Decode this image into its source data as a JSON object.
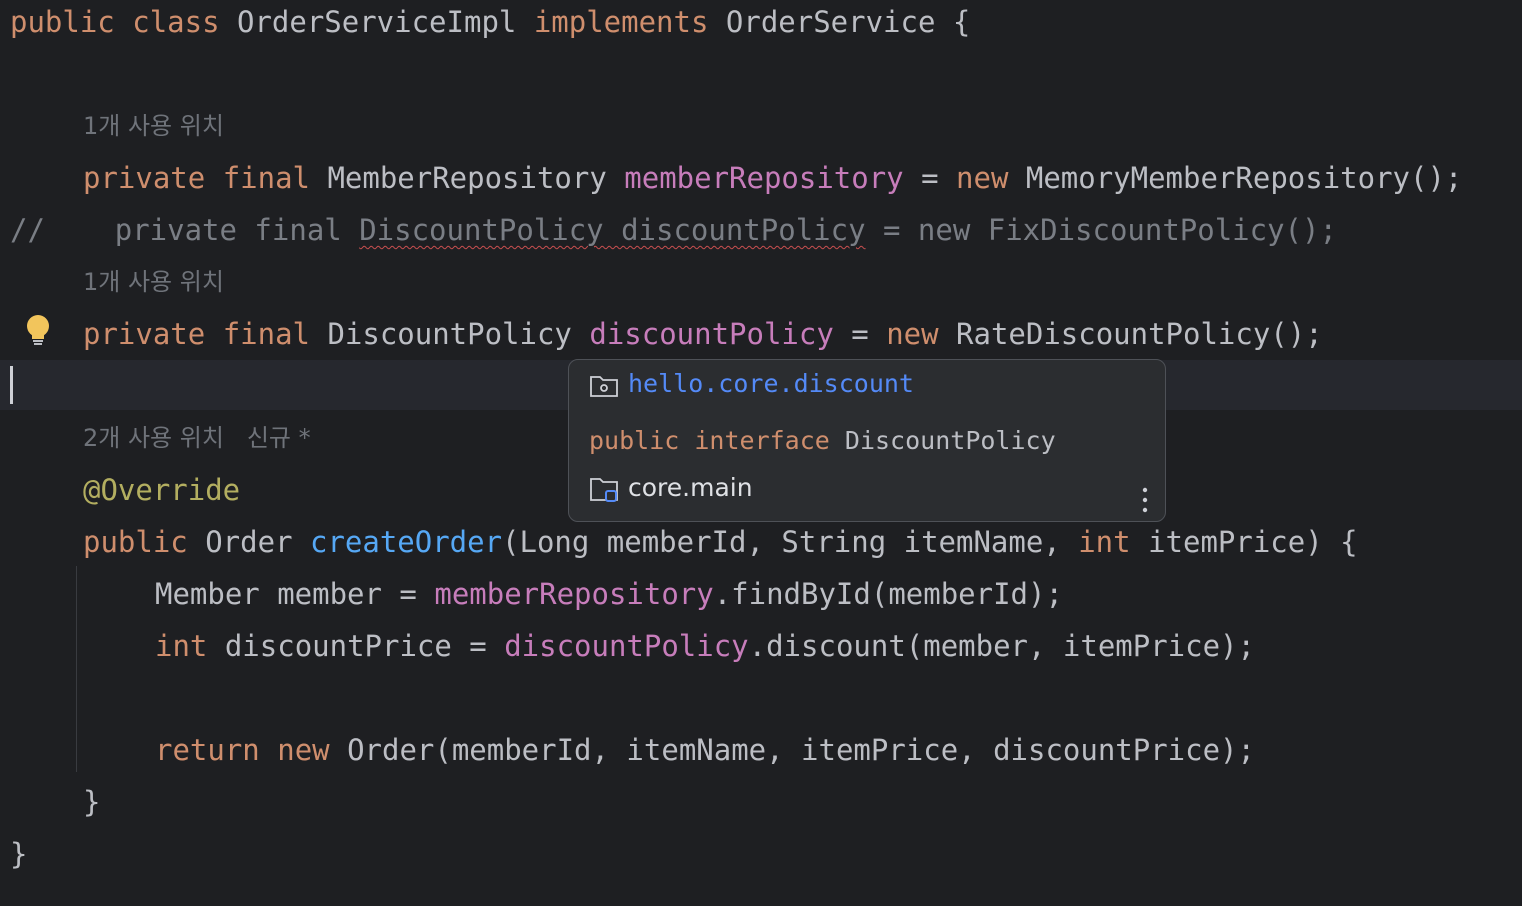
{
  "lines": {
    "l1": {
      "p1": "public",
      "p2": " ",
      "p3": "class",
      "p4": " OrderServiceImpl ",
      "p5": "implements",
      "p6": " OrderService {"
    },
    "hint1": "1개 사용 위치",
    "l2": {
      "p1": "private",
      "p2": " ",
      "p3": "final",
      "p4": " MemberRepository ",
      "p5": "memberRepository",
      "p6": " = ",
      "p7": "new",
      "p8": " MemoryMemberRepository();"
    },
    "l3": {
      "p1": "//",
      "p2": "    private final ",
      "p3": "DiscountPolicy discountPolicy",
      "p4": " = new FixDiscountPolicy();"
    },
    "hint2": "1개 사용 위치",
    "l4": {
      "p1": "private",
      "p2": " ",
      "p3": "final",
      "p4": " DiscountPolicy ",
      "p5": "discountPolicy",
      "p6": " = ",
      "p7": "new",
      "p8": " RateDiscountPolicy();"
    },
    "hint3": "2개 사용 위치   신규 *",
    "l5": {
      "p1": "@Override"
    },
    "l6": {
      "p1": "public",
      "p2": " Order ",
      "p3": "createOrder",
      "p4": "(Long memberId, String itemName, ",
      "p5": "int",
      "p6": " itemPrice) {"
    },
    "l7": {
      "p1": "Member member = ",
      "p2": "memberRepository",
      "p3": ".findById(memberId);"
    },
    "l8": {
      "p1": "int",
      "p2": " discountPrice = ",
      "p3": "discountPolicy",
      "p4": ".discount(member, itemPrice);"
    },
    "l9": {
      "p1": "return",
      "p2": " ",
      "p3": "new",
      "p4": " Order(memberId, itemName, itemPrice, discountPrice);"
    },
    "l10": {
      "p1": "}"
    },
    "l11": {
      "p1": "}"
    }
  },
  "popup": {
    "package": "hello.core.discount",
    "decl_modifier": "public",
    "decl_keyword": "interface",
    "decl_name": "DiscountPolicy",
    "module": "core.main"
  },
  "icons": {
    "bulb": "lightbulb-icon",
    "package": "package-icon",
    "module": "module-folder-icon",
    "more": "more-vertical-icon"
  },
  "colors": {
    "background": "#1e1f22",
    "keyword": "#cf8e6d",
    "field": "#c77dbb",
    "method": "#56a8f5",
    "annotation": "#b3ae60",
    "comment": "#7a7e85",
    "popup_link": "#548af7",
    "bulb": "#f2c55c"
  }
}
